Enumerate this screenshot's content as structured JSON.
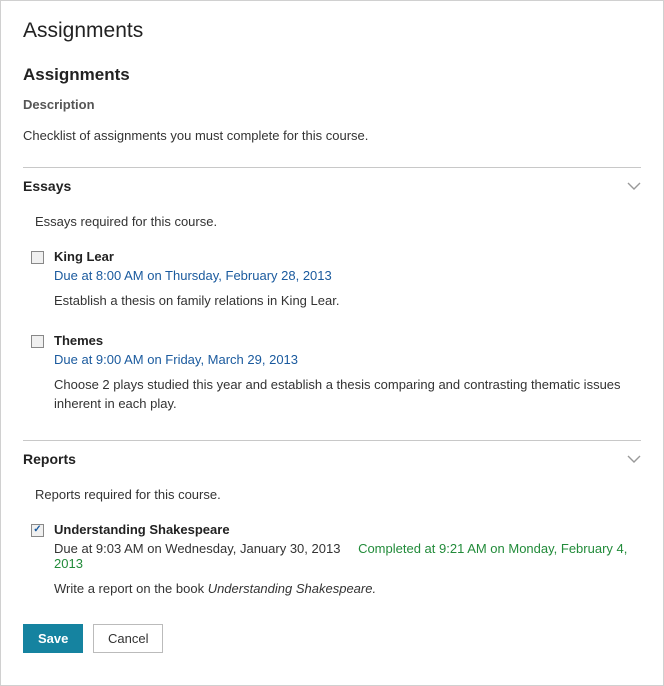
{
  "page": {
    "title": "Assignments",
    "subtitle": "Assignments",
    "description_label": "Description",
    "description_text": "Checklist of assignments you must complete for this course."
  },
  "categories": [
    {
      "title": "Essays",
      "description": "Essays required for this course.",
      "items": [
        {
          "title": "King Lear",
          "checked": false,
          "due": "Due at 8:00 AM on Thursday, February 28, 2013",
          "completed": "",
          "desc_plain": "Establish a thesis on family relations in King Lear.",
          "desc_italic": ""
        },
        {
          "title": "Themes",
          "checked": false,
          "due": "Due at 9:00 AM on Friday, March 29, 2013",
          "completed": "",
          "desc_plain": "Choose 2 plays studied this year and establish a thesis comparing and contrasting thematic issues inherent in each play.",
          "desc_italic": ""
        }
      ]
    },
    {
      "title": "Reports",
      "description": "Reports required for this course.",
      "items": [
        {
          "title": "Understanding Shakespeare",
          "checked": true,
          "due": "Due at 9:03 AM on Wednesday, January 30, 2013",
          "completed": "Completed at 9:21 AM on Monday, February 4, 2013",
          "desc_plain": "Write a report on the book ",
          "desc_italic": "Understanding Shakespeare."
        }
      ]
    }
  ],
  "buttons": {
    "save": "Save",
    "cancel": "Cancel"
  }
}
